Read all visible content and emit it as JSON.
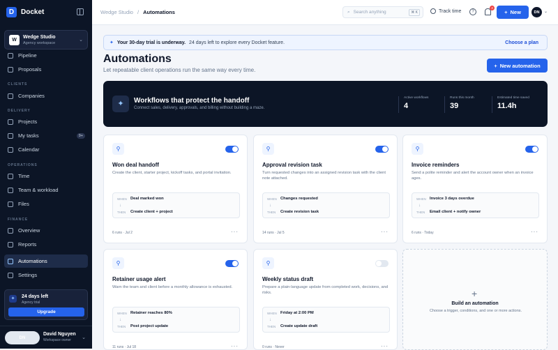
{
  "app": {
    "name": "Docket"
  },
  "workspace": {
    "initial": "W",
    "name": "Wedge Studio",
    "subtitle": "Agency workspace"
  },
  "nav": {
    "pipeline": "Pipeline",
    "proposals": "Proposals",
    "clients_section": "CLIENTS",
    "companies": "Companies",
    "delivery_section": "DELIVERY",
    "projects": "Projects",
    "my_tasks": "My tasks",
    "my_tasks_count": "9+",
    "calendar": "Calendar",
    "operations_section": "OPERATIONS",
    "time": "Time",
    "team_workload": "Team & workload",
    "files": "Files",
    "finance_section": "FINANCE",
    "overview": "Overview",
    "reports": "Reports",
    "automations": "Automations",
    "settings": "Settings"
  },
  "trial_box": {
    "title": "24 days left",
    "subtitle": "Agency trial",
    "button": "Upgrade"
  },
  "user": {
    "initials": "DN",
    "name": "David Nguyen",
    "role": "Workspace owner"
  },
  "topbar": {
    "crumb_parent": "Wedge Studio",
    "crumb_sep": "/",
    "crumb_current": "Automations",
    "search_placeholder": "Search anything",
    "search_kbd": "⌘ K",
    "track_time": "Track time",
    "help": "?",
    "notif_count": "3",
    "new_label": "New",
    "avatar": "DN"
  },
  "banner": {
    "bold": "Your 30-day trial is underway.",
    "text": "24 days left to explore every Docket feature.",
    "link": "Choose a plan"
  },
  "page": {
    "title": "Automations",
    "subtitle": "Let repeatable client operations run the same way every time.",
    "new_button": "New automation"
  },
  "hero": {
    "title": "Workflows that protect the handoff",
    "subtitle": "Connect sales, delivery, approvals, and billing without building a maze.",
    "stats": [
      {
        "label": "Active workflows",
        "value": "4"
      },
      {
        "label": "Runs this month",
        "value": "39"
      },
      {
        "label": "Estimated time saved",
        "value": "11.4h"
      }
    ]
  },
  "flow_labels": {
    "when": "WHEN",
    "then": "THEN"
  },
  "cards": [
    {
      "title": "Won deal handoff",
      "desc": "Create the client, starter project, kickoff tasks, and portal invitation.",
      "when": "Deal marked won",
      "then": "Create client + project",
      "footer": "6 runs · Jul 2",
      "enabled": true
    },
    {
      "title": "Approval revision task",
      "desc": "Turn requested changes into an assigned revision task with the client note attached.",
      "when": "Changes requested",
      "then": "Create revision task",
      "footer": "14 runs · Jul 5",
      "enabled": true
    },
    {
      "title": "Invoice reminders",
      "desc": "Send a polite reminder and alert the account owner when an invoice ages.",
      "when": "Invoice 3 days overdue",
      "then": "Email client + notify owner",
      "footer": "6 runs · Today",
      "enabled": true
    },
    {
      "title": "Retainer usage alert",
      "desc": "Warn the team and client before a monthly allowance is exhausted.",
      "when": "Retainer reaches 80%",
      "then": "Post project update",
      "footer": "11 runs · Jul 18",
      "enabled": true
    },
    {
      "title": "Weekly status draft",
      "desc": "Prepare a plain-language update from completed work, decisions, and risks.",
      "when": "Friday at 2:00 PM",
      "then": "Create update draft",
      "footer": "0 runs · Never",
      "enabled": false
    }
  ],
  "build": {
    "plus": "+",
    "title": "Build an automation",
    "subtitle": "Choose a trigger, conditions, and one or more actions."
  },
  "icons": {
    "brand": "docket-logo",
    "more": "more-dots-icon"
  }
}
